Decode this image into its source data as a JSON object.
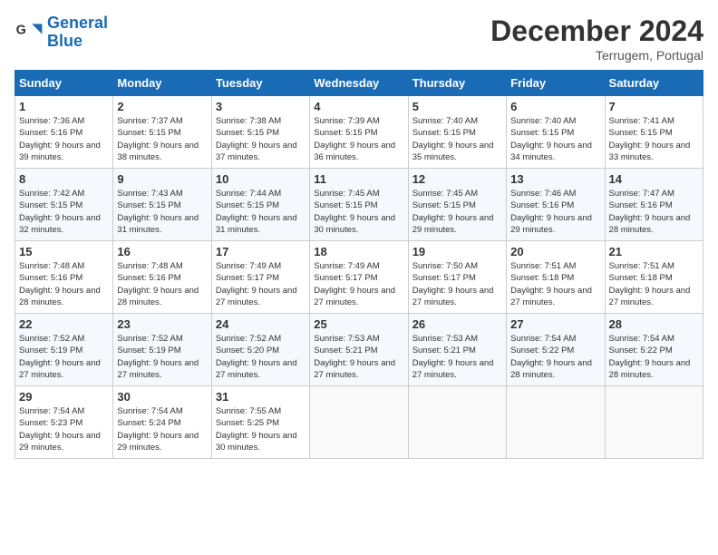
{
  "header": {
    "logo_line1": "General",
    "logo_line2": "Blue",
    "month": "December 2024",
    "location": "Terrugem, Portugal"
  },
  "weekdays": [
    "Sunday",
    "Monday",
    "Tuesday",
    "Wednesday",
    "Thursday",
    "Friday",
    "Saturday"
  ],
  "weeks": [
    [
      {
        "day": "1",
        "sunrise": "Sunrise: 7:36 AM",
        "sunset": "Sunset: 5:16 PM",
        "daylight": "Daylight: 9 hours and 39 minutes."
      },
      {
        "day": "2",
        "sunrise": "Sunrise: 7:37 AM",
        "sunset": "Sunset: 5:15 PM",
        "daylight": "Daylight: 9 hours and 38 minutes."
      },
      {
        "day": "3",
        "sunrise": "Sunrise: 7:38 AM",
        "sunset": "Sunset: 5:15 PM",
        "daylight": "Daylight: 9 hours and 37 minutes."
      },
      {
        "day": "4",
        "sunrise": "Sunrise: 7:39 AM",
        "sunset": "Sunset: 5:15 PM",
        "daylight": "Daylight: 9 hours and 36 minutes."
      },
      {
        "day": "5",
        "sunrise": "Sunrise: 7:40 AM",
        "sunset": "Sunset: 5:15 PM",
        "daylight": "Daylight: 9 hours and 35 minutes."
      },
      {
        "day": "6",
        "sunrise": "Sunrise: 7:40 AM",
        "sunset": "Sunset: 5:15 PM",
        "daylight": "Daylight: 9 hours and 34 minutes."
      },
      {
        "day": "7",
        "sunrise": "Sunrise: 7:41 AM",
        "sunset": "Sunset: 5:15 PM",
        "daylight": "Daylight: 9 hours and 33 minutes."
      }
    ],
    [
      {
        "day": "8",
        "sunrise": "Sunrise: 7:42 AM",
        "sunset": "Sunset: 5:15 PM",
        "daylight": "Daylight: 9 hours and 32 minutes."
      },
      {
        "day": "9",
        "sunrise": "Sunrise: 7:43 AM",
        "sunset": "Sunset: 5:15 PM",
        "daylight": "Daylight: 9 hours and 31 minutes."
      },
      {
        "day": "10",
        "sunrise": "Sunrise: 7:44 AM",
        "sunset": "Sunset: 5:15 PM",
        "daylight": "Daylight: 9 hours and 31 minutes."
      },
      {
        "day": "11",
        "sunrise": "Sunrise: 7:45 AM",
        "sunset": "Sunset: 5:15 PM",
        "daylight": "Daylight: 9 hours and 30 minutes."
      },
      {
        "day": "12",
        "sunrise": "Sunrise: 7:45 AM",
        "sunset": "Sunset: 5:15 PM",
        "daylight": "Daylight: 9 hours and 29 minutes."
      },
      {
        "day": "13",
        "sunrise": "Sunrise: 7:46 AM",
        "sunset": "Sunset: 5:16 PM",
        "daylight": "Daylight: 9 hours and 29 minutes."
      },
      {
        "day": "14",
        "sunrise": "Sunrise: 7:47 AM",
        "sunset": "Sunset: 5:16 PM",
        "daylight": "Daylight: 9 hours and 28 minutes."
      }
    ],
    [
      {
        "day": "15",
        "sunrise": "Sunrise: 7:48 AM",
        "sunset": "Sunset: 5:16 PM",
        "daylight": "Daylight: 9 hours and 28 minutes."
      },
      {
        "day": "16",
        "sunrise": "Sunrise: 7:48 AM",
        "sunset": "Sunset: 5:16 PM",
        "daylight": "Daylight: 9 hours and 28 minutes."
      },
      {
        "day": "17",
        "sunrise": "Sunrise: 7:49 AM",
        "sunset": "Sunset: 5:17 PM",
        "daylight": "Daylight: 9 hours and 27 minutes."
      },
      {
        "day": "18",
        "sunrise": "Sunrise: 7:49 AM",
        "sunset": "Sunset: 5:17 PM",
        "daylight": "Daylight: 9 hours and 27 minutes."
      },
      {
        "day": "19",
        "sunrise": "Sunrise: 7:50 AM",
        "sunset": "Sunset: 5:17 PM",
        "daylight": "Daylight: 9 hours and 27 minutes."
      },
      {
        "day": "20",
        "sunrise": "Sunrise: 7:51 AM",
        "sunset": "Sunset: 5:18 PM",
        "daylight": "Daylight: 9 hours and 27 minutes."
      },
      {
        "day": "21",
        "sunrise": "Sunrise: 7:51 AM",
        "sunset": "Sunset: 5:18 PM",
        "daylight": "Daylight: 9 hours and 27 minutes."
      }
    ],
    [
      {
        "day": "22",
        "sunrise": "Sunrise: 7:52 AM",
        "sunset": "Sunset: 5:19 PM",
        "daylight": "Daylight: 9 hours and 27 minutes."
      },
      {
        "day": "23",
        "sunrise": "Sunrise: 7:52 AM",
        "sunset": "Sunset: 5:19 PM",
        "daylight": "Daylight: 9 hours and 27 minutes."
      },
      {
        "day": "24",
        "sunrise": "Sunrise: 7:52 AM",
        "sunset": "Sunset: 5:20 PM",
        "daylight": "Daylight: 9 hours and 27 minutes."
      },
      {
        "day": "25",
        "sunrise": "Sunrise: 7:53 AM",
        "sunset": "Sunset: 5:21 PM",
        "daylight": "Daylight: 9 hours and 27 minutes."
      },
      {
        "day": "26",
        "sunrise": "Sunrise: 7:53 AM",
        "sunset": "Sunset: 5:21 PM",
        "daylight": "Daylight: 9 hours and 27 minutes."
      },
      {
        "day": "27",
        "sunrise": "Sunrise: 7:54 AM",
        "sunset": "Sunset: 5:22 PM",
        "daylight": "Daylight: 9 hours and 28 minutes."
      },
      {
        "day": "28",
        "sunrise": "Sunrise: 7:54 AM",
        "sunset": "Sunset: 5:22 PM",
        "daylight": "Daylight: 9 hours and 28 minutes."
      }
    ],
    [
      {
        "day": "29",
        "sunrise": "Sunrise: 7:54 AM",
        "sunset": "Sunset: 5:23 PM",
        "daylight": "Daylight: 9 hours and 29 minutes."
      },
      {
        "day": "30",
        "sunrise": "Sunrise: 7:54 AM",
        "sunset": "Sunset: 5:24 PM",
        "daylight": "Daylight: 9 hours and 29 minutes."
      },
      {
        "day": "31",
        "sunrise": "Sunrise: 7:55 AM",
        "sunset": "Sunset: 5:25 PM",
        "daylight": "Daylight: 9 hours and 30 minutes."
      },
      null,
      null,
      null,
      null
    ]
  ]
}
